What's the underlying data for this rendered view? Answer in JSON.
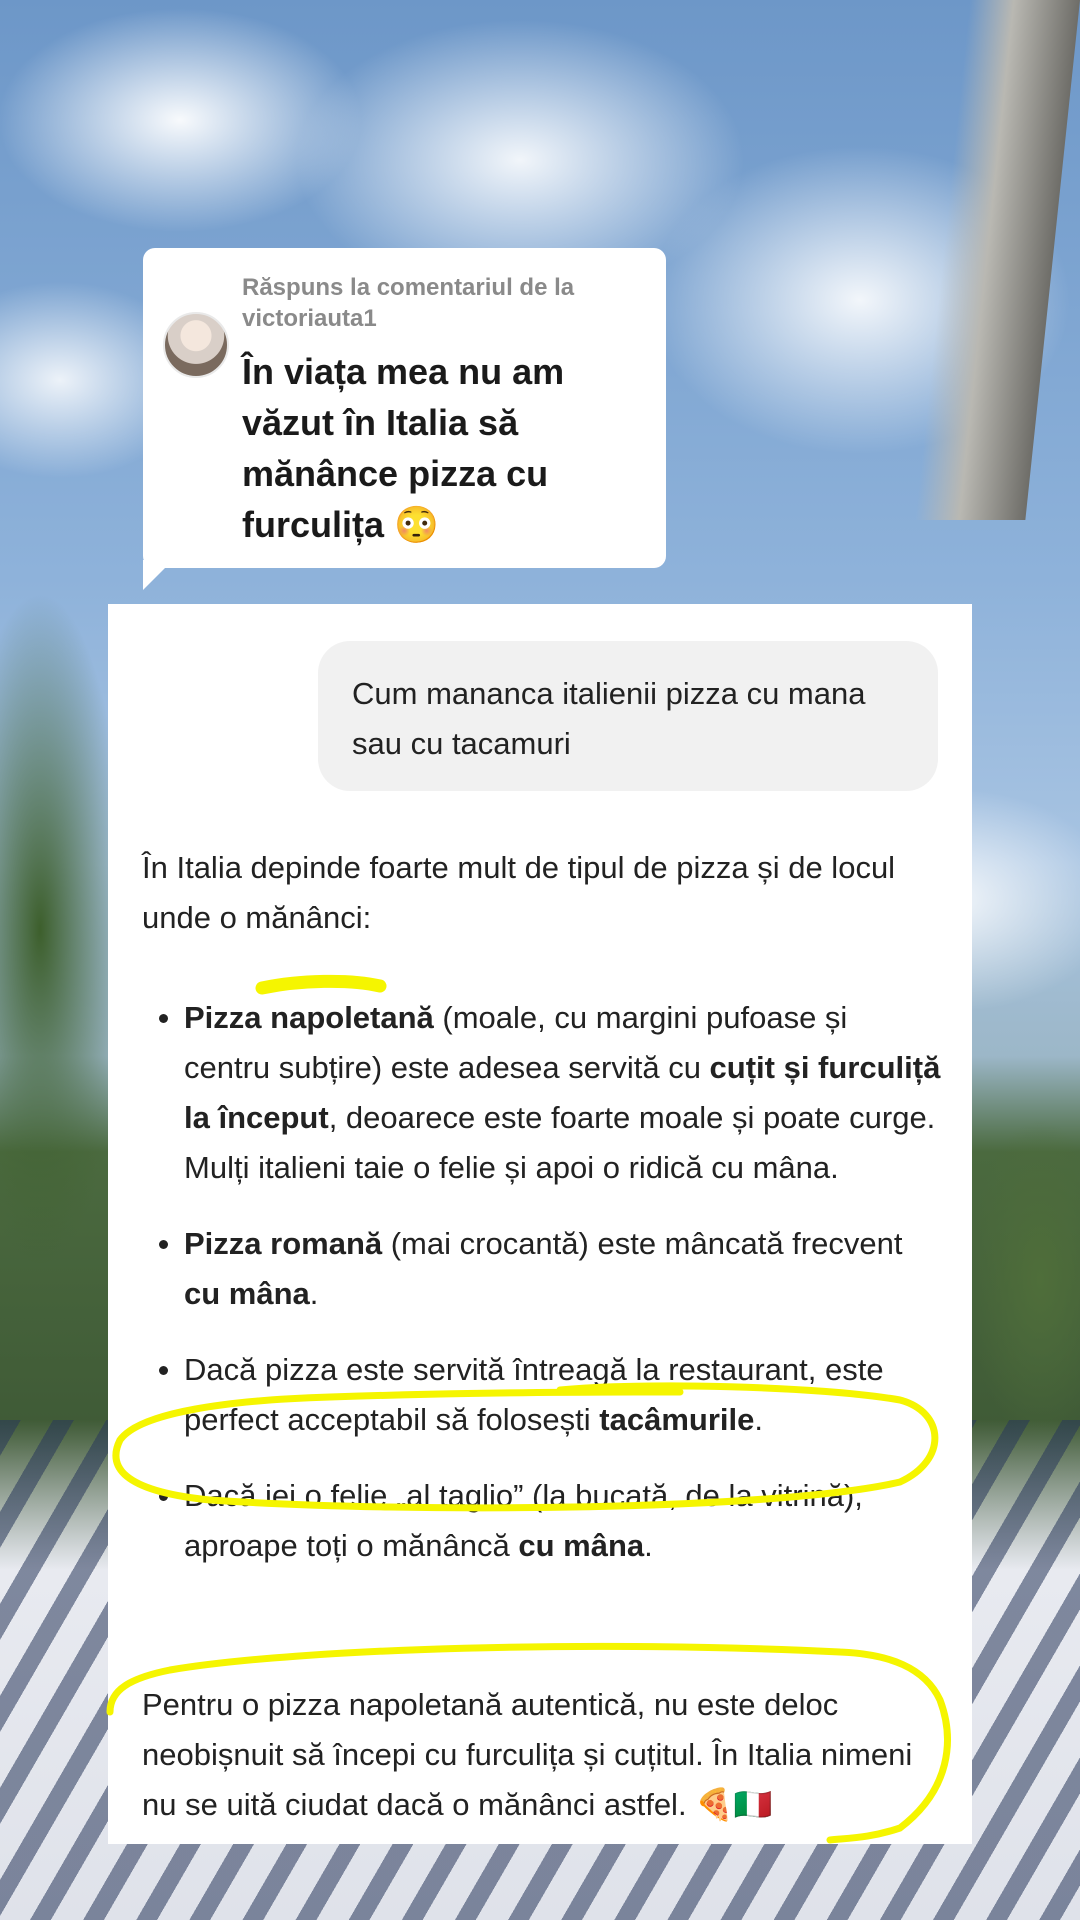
{
  "reply": {
    "label": "Răspuns la comentariul de la victoriauta1",
    "comment": "În viața mea nu am văzut în Italia să mănânce pizza cu furculița 😳"
  },
  "chat": {
    "question": "Cum mananca italienii pizza cu mana sau cu tacamuri",
    "intro": "În Italia depinde foarte mult de tipul de pizza și de locul unde o mănânci:",
    "bullets": [
      {
        "b1": "Pizza napoletană",
        "t1": " (moale, cu margini pufoase și centru subțire) este adesea servită cu ",
        "b2": "cuțit și furculiță la început",
        "t2": ", deoarece este foarte moale și poate curge. Mulți italieni taie o felie și apoi o ridică cu mâna."
      },
      {
        "b1": "Pizza romană",
        "t1": " (mai crocantă) este mâncată frecvent ",
        "b2": "cu mâna",
        "t2": "."
      },
      {
        "t1": "Dacă pizza este servită întreagă la restaurant, este perfect acceptabil să folosești ",
        "b2": "tacâmurile",
        "t2": "."
      },
      {
        "t1": "Dacă iei o felie „al taglio” (la bucată, de la vitrină), aproape toți o mănâncă ",
        "b2": "cu mâna",
        "t2": "."
      }
    ],
    "outro": "Pentru o pizza napoletană autentică, nu este deloc neobișnuit să începi cu furculița și cuțitul. În Italia nimeni nu se uită ciudat dacă o mănânci astfel. 🍕🇮🇹"
  },
  "colors": {
    "highlighter": "#f5f500",
    "bubble": "#f1f1f1",
    "text": "#222222"
  }
}
